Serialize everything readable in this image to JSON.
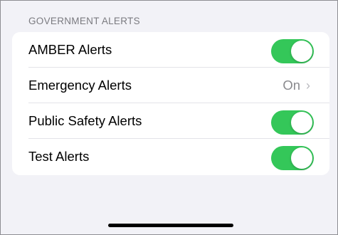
{
  "section": {
    "header": "GOVERNMENT ALERTS"
  },
  "rows": [
    {
      "label": "AMBER Alerts",
      "toggle_on": true
    },
    {
      "label": "Emergency Alerts",
      "detail": "On",
      "chevron": "›"
    },
    {
      "label": "Public Safety Alerts",
      "toggle_on": true
    },
    {
      "label": "Test Alerts",
      "toggle_on": true
    }
  ],
  "colors": {
    "toggle_on": "#34c759",
    "background": "#f2f2f7"
  },
  "icons": {
    "chevron": "chevron-right-icon"
  }
}
